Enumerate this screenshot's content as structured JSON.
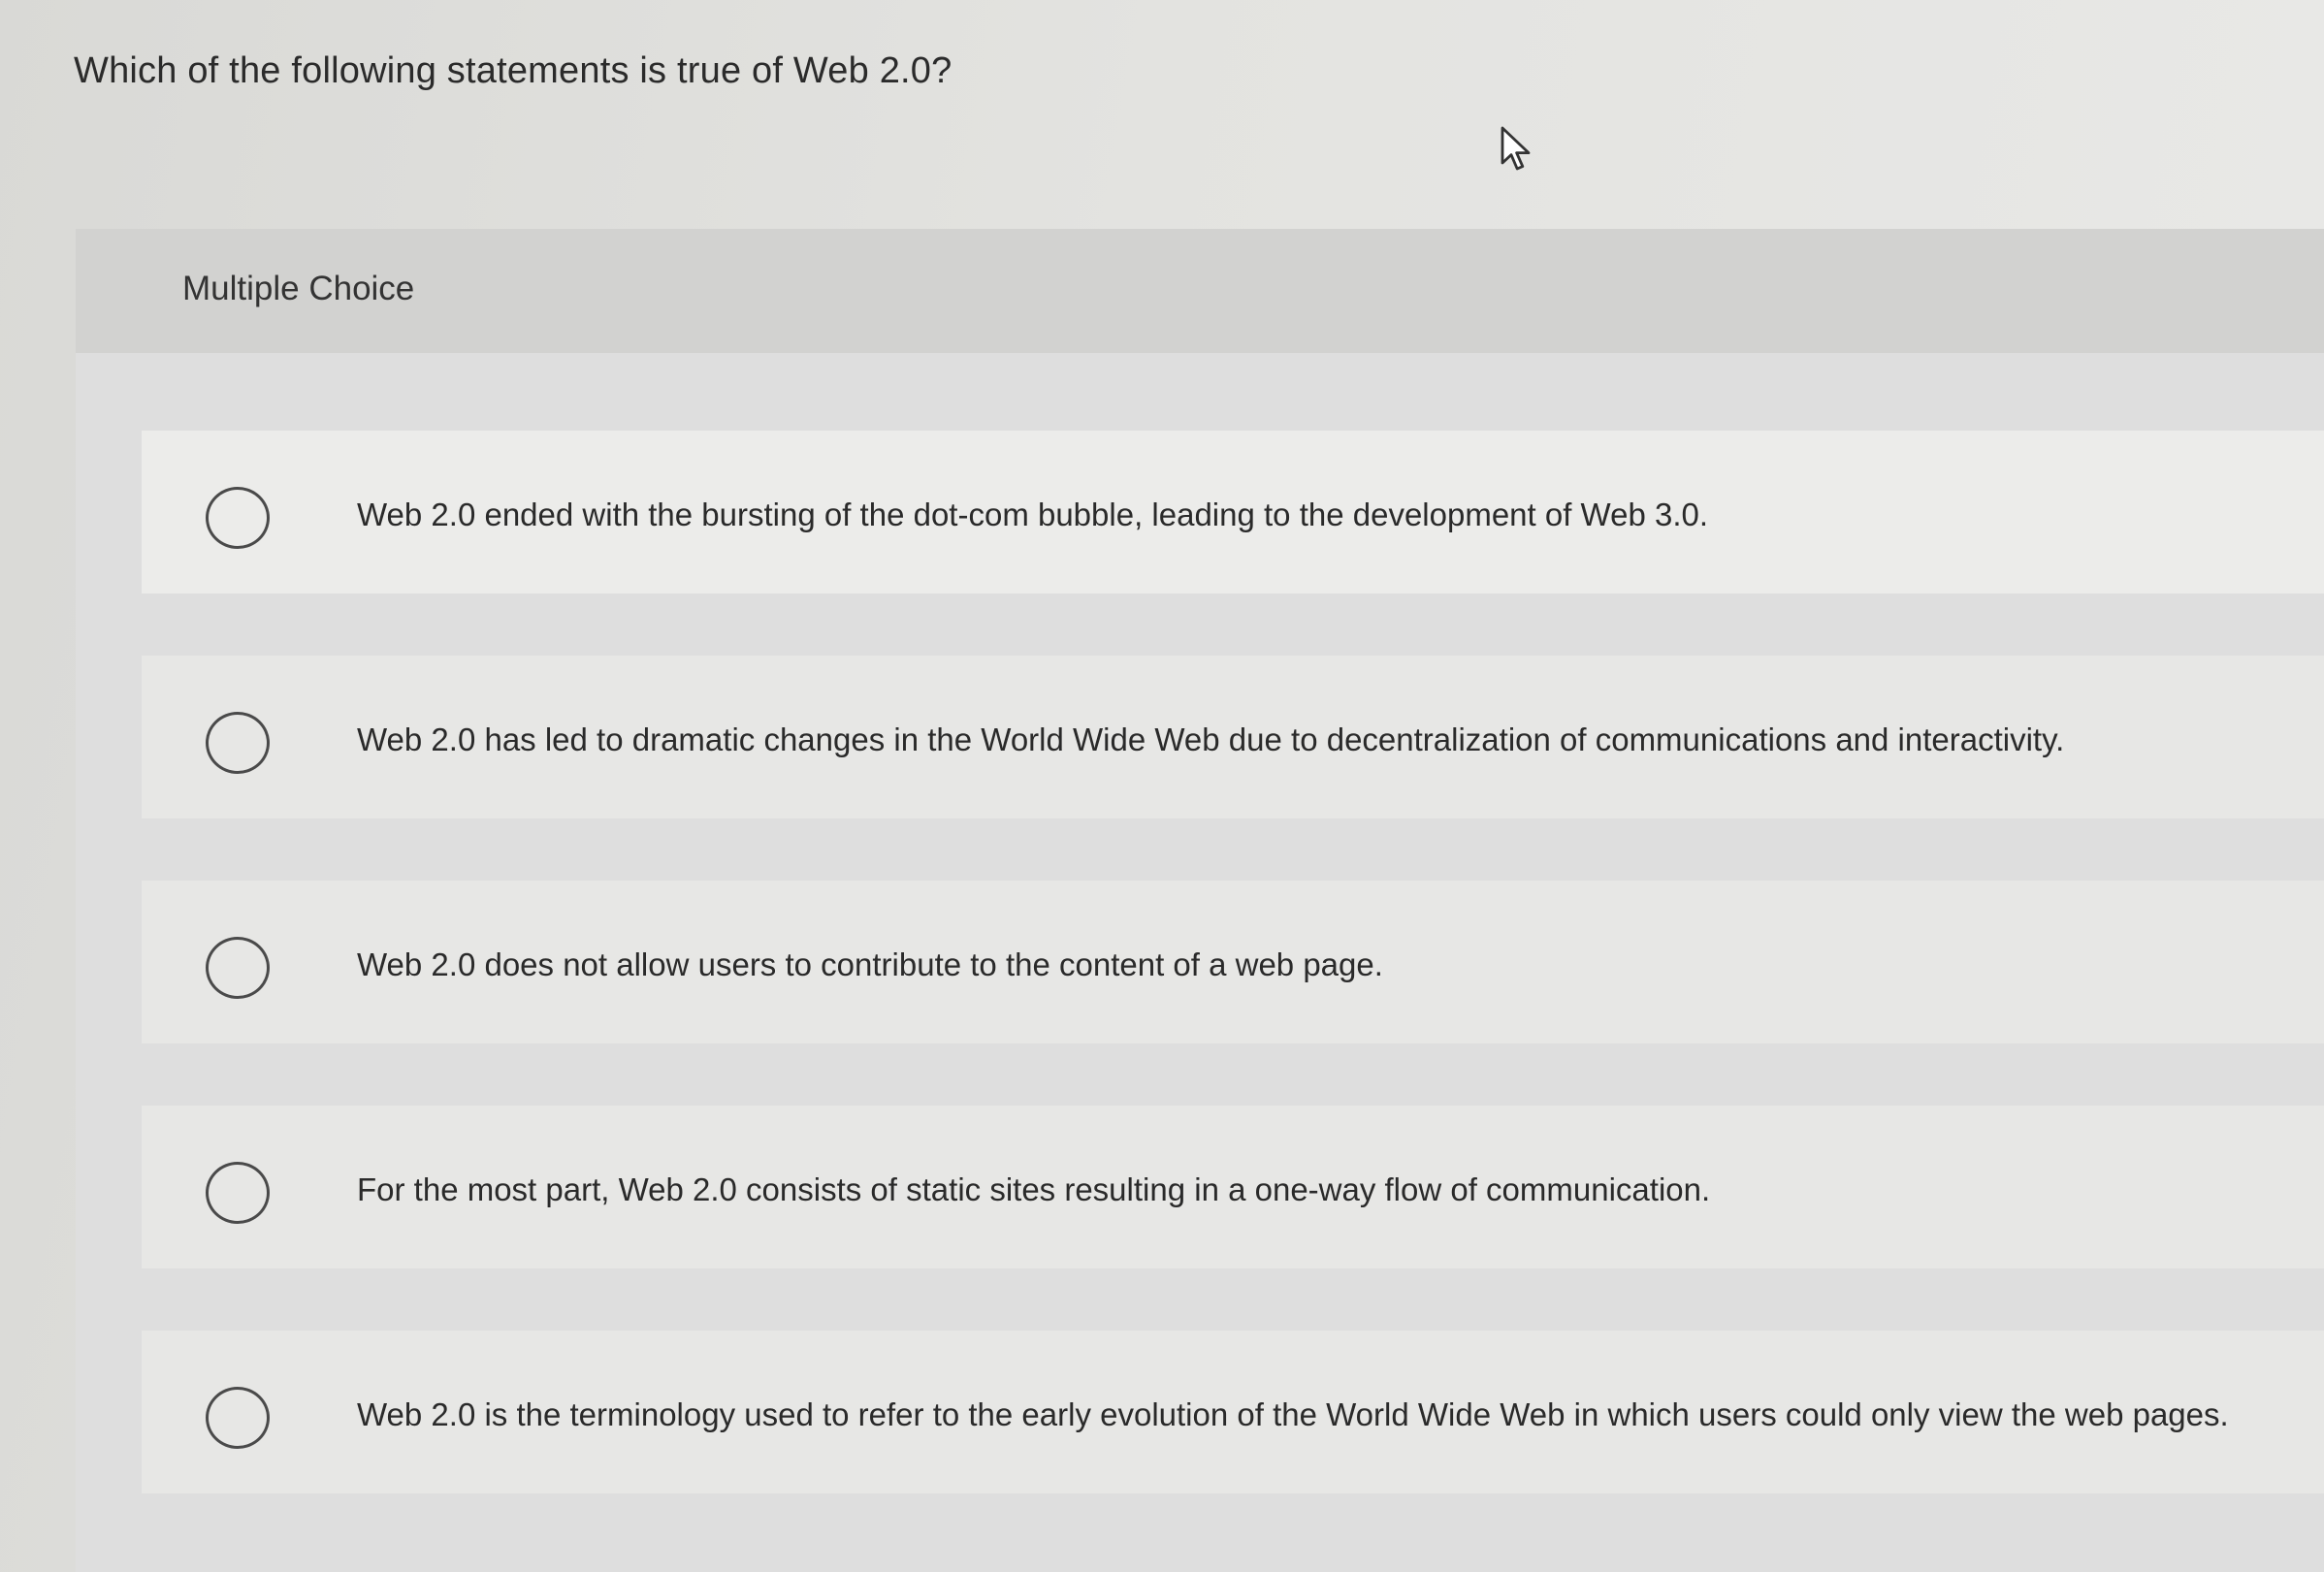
{
  "question": {
    "text": "Which of the following statements is true of Web 2.0?"
  },
  "question_type": {
    "label": "Multiple Choice"
  },
  "options": [
    {
      "label": "Web 2.0 ended with the bursting of the dot-com bubble, leading to the development of Web 3.0.",
      "selected": false
    },
    {
      "label": "Web 2.0 has led to dramatic changes in the World Wide Web due to decentralization of communications and interactivity.",
      "selected": false
    },
    {
      "label": "Web 2.0 does not allow users to contribute to the content of a web page.",
      "selected": false
    },
    {
      "label": "For the most part, Web 2.0 consists of static sites resulting in a one-way flow of communication.",
      "selected": false
    },
    {
      "label": "Web 2.0 is the terminology used to refer to the early evolution of the World Wide Web in which users could only view the web pages.",
      "selected": false
    }
  ],
  "icons": {
    "cursor": "mouse-pointer-icon",
    "radio": "radio-unselected-icon"
  }
}
